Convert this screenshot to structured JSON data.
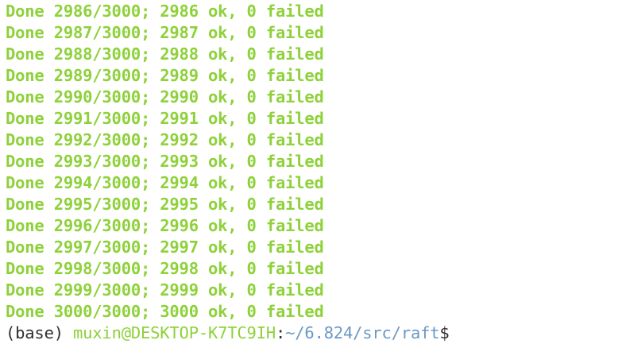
{
  "colors": {
    "output": "#8ed13a",
    "user_host": "#8ed13a",
    "path": "#6b99c6",
    "text": "#2f2f2f"
  },
  "output_lines": [
    "Done 2986/3000; 2986 ok, 0 failed",
    "Done 2987/3000; 2987 ok, 0 failed",
    "Done 2988/3000; 2988 ok, 0 failed",
    "Done 2989/3000; 2989 ok, 0 failed",
    "Done 2990/3000; 2990 ok, 0 failed",
    "Done 2991/3000; 2991 ok, 0 failed",
    "Done 2992/3000; 2992 ok, 0 failed",
    "Done 2993/3000; 2993 ok, 0 failed",
    "Done 2994/3000; 2994 ok, 0 failed",
    "Done 2995/3000; 2995 ok, 0 failed",
    "Done 2996/3000; 2996 ok, 0 failed",
    "Done 2997/3000; 2997 ok, 0 failed",
    "Done 2998/3000; 2998 ok, 0 failed",
    "Done 2999/3000; 2999 ok, 0 failed",
    "Done 3000/3000; 3000 ok, 0 failed"
  ],
  "prompt": {
    "env": "(base) ",
    "user_host": "muxin@DESKTOP-K7TC9IH",
    "separator": ":",
    "path": "~/6.824/src/raft",
    "symbol": "$"
  }
}
